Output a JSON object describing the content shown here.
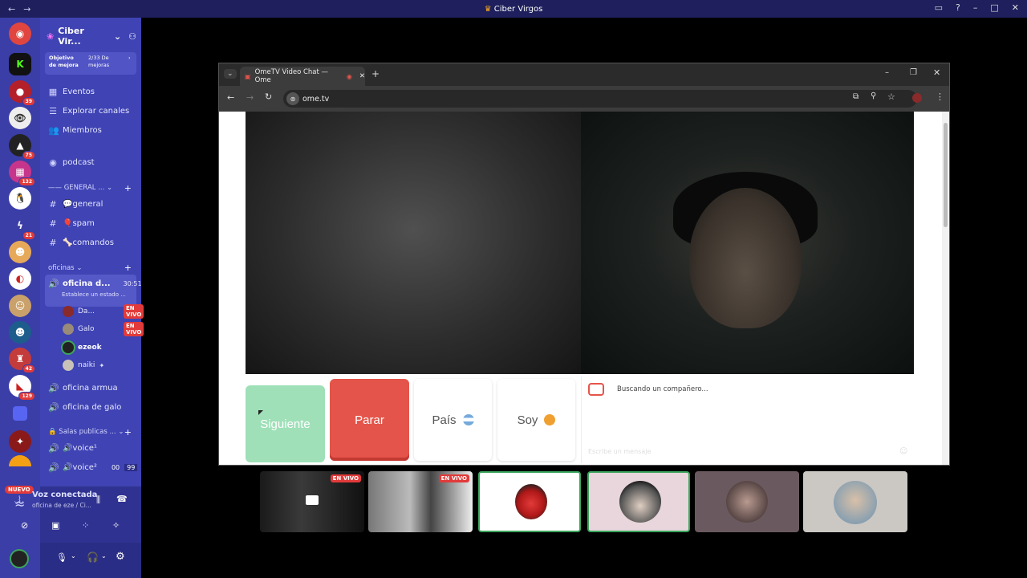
{
  "window": {
    "title": "Ciber Virgos"
  },
  "servers": {
    "badges": [
      "39",
      "75",
      "132",
      "21",
      "42",
      "129"
    ],
    "nuevo": "NUEVO"
  },
  "sidebar": {
    "server_name": "Ciber Vir...",
    "goal": {
      "label": "Objetivo de mejora",
      "progress": "2/33 De mejoras"
    },
    "items": [
      {
        "label": "Eventos",
        "icon": "calendar-icon"
      },
      {
        "label": "Explorar canales",
        "icon": "explore-icon"
      },
      {
        "label": "Miembros",
        "icon": "members-icon"
      },
      {
        "label": "podcast",
        "icon": "stage-icon"
      }
    ],
    "category_general": "GENERAL ...",
    "text_channels": [
      {
        "label": "💬general"
      },
      {
        "label": "🎈spam"
      },
      {
        "label": "🦴comandos"
      }
    ],
    "category_oficinas": "oficinas",
    "voice_active": {
      "label": "oficina d...",
      "timer": "30:51",
      "status": "Establece un estado ..."
    },
    "users": [
      {
        "name": "Da...",
        "live": "EN VIVO"
      },
      {
        "name": "Galo",
        "live": "EN VIVO"
      },
      {
        "name": "ezeok",
        "live": ""
      },
      {
        "name": "naiki",
        "live": ""
      }
    ],
    "voice_channels": [
      {
        "label": "oficina armua"
      },
      {
        "label": "oficina de galo"
      }
    ],
    "category_salas": "Salas publicas ...",
    "salas": [
      {
        "label": "🔊voice¹",
        "count_a": "",
        "count_b": ""
      },
      {
        "label": "🔊voice²",
        "count_a": "00",
        "count_b": "99"
      }
    ]
  },
  "voice_panel": {
    "status": "Voz conectada",
    "channel": "oficina de eze / Ci..."
  },
  "browser": {
    "tab_title": "OmeTV Video Chat — Ome",
    "url": "ome.tv"
  },
  "ometv": {
    "next_label": "Siguiente",
    "stop_label": "Parar",
    "country_label": "País",
    "gender_label": "Soy",
    "searching": "Buscando un compañero...",
    "message_placeholder": "Escribe un mensaje"
  },
  "stream_tiles": {
    "live_label_1": "EN VIVO",
    "live_label_2": "EN VIVO"
  },
  "colors": {
    "next": "#9fe0b8",
    "stop": "#e5544a",
    "rail": "#3b3ea6",
    "channel_panel": "#3f43b3"
  }
}
